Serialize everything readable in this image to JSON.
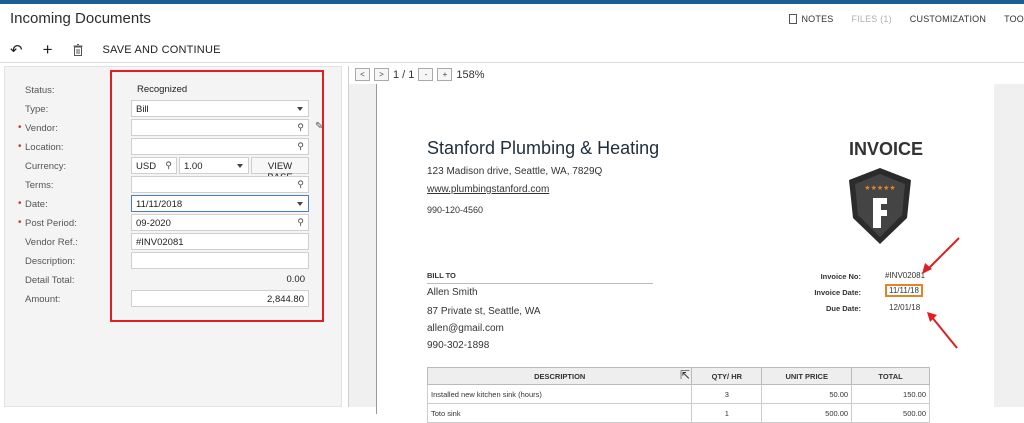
{
  "header": {
    "title": "Incoming Documents",
    "nav": [
      "NOTES",
      "FILES (1)",
      "CUSTOMIZATION",
      "TOO"
    ]
  },
  "toolbar": {
    "save_label": "SAVE AND CONTINUE"
  },
  "form": {
    "status_label": "Status:",
    "status_value": "Recognized",
    "type_label": "Type:",
    "type_value": "Bill",
    "vendor_label": "Vendor:",
    "vendor_value": "",
    "location_label": "Location:",
    "location_value": "",
    "currency_label": "Currency:",
    "currency_value": "USD",
    "rate_value": "1.00",
    "view_base_label": "VIEW BASE",
    "terms_label": "Terms:",
    "terms_value": "",
    "date_label": "Date:",
    "date_value": "11/11/2018",
    "post_period_label": "Post Period:",
    "post_period_value": "09-2020",
    "vendor_ref_label": "Vendor Ref.:",
    "vendor_ref_value": "#INV02081",
    "description_label": "Description:",
    "description_value": "",
    "detail_total_label": "Detail Total:",
    "detail_total_value": "0.00",
    "amount_label": "Amount:",
    "amount_value": "2,844.80"
  },
  "viewer": {
    "page_indicator": "1 / 1",
    "zoom": "158%"
  },
  "invoice": {
    "company": "Stanford Plumbing & Heating",
    "address": "123 Madison drive, Seattle, WA, 7829Q",
    "website": "www.plumbingstanford.com",
    "phone": "990-120-4560",
    "title": "INVOICE",
    "bill_to_heading": "BILL TO",
    "bill_to": [
      "Allen Smith",
      "87 Private st, Seattle, WA",
      "allen@gmail.com",
      "990-302-1898"
    ],
    "invoice_no_label": "Invoice No:",
    "invoice_no": "#INV02081",
    "invoice_date_label": "Invoice Date:",
    "invoice_date": "11/11/18",
    "due_date_label": "Due Date:",
    "due_date": "12/01/18",
    "table_headers": [
      "DESCRIPTION",
      "QTY/ HR",
      "UNIT PRICE",
      "TOTAL"
    ],
    "table_rows": [
      [
        "Installed new kitchen sink (hours)",
        "3",
        "50.00",
        "150.00"
      ],
      [
        "Toto sink",
        "1",
        "500.00",
        "500.00"
      ]
    ]
  },
  "colors": {
    "accent_strip": "#1b5e96",
    "highlight_red": "#e01f24",
    "date_box": "#e4832a",
    "required_marker": "#c53a3a"
  }
}
